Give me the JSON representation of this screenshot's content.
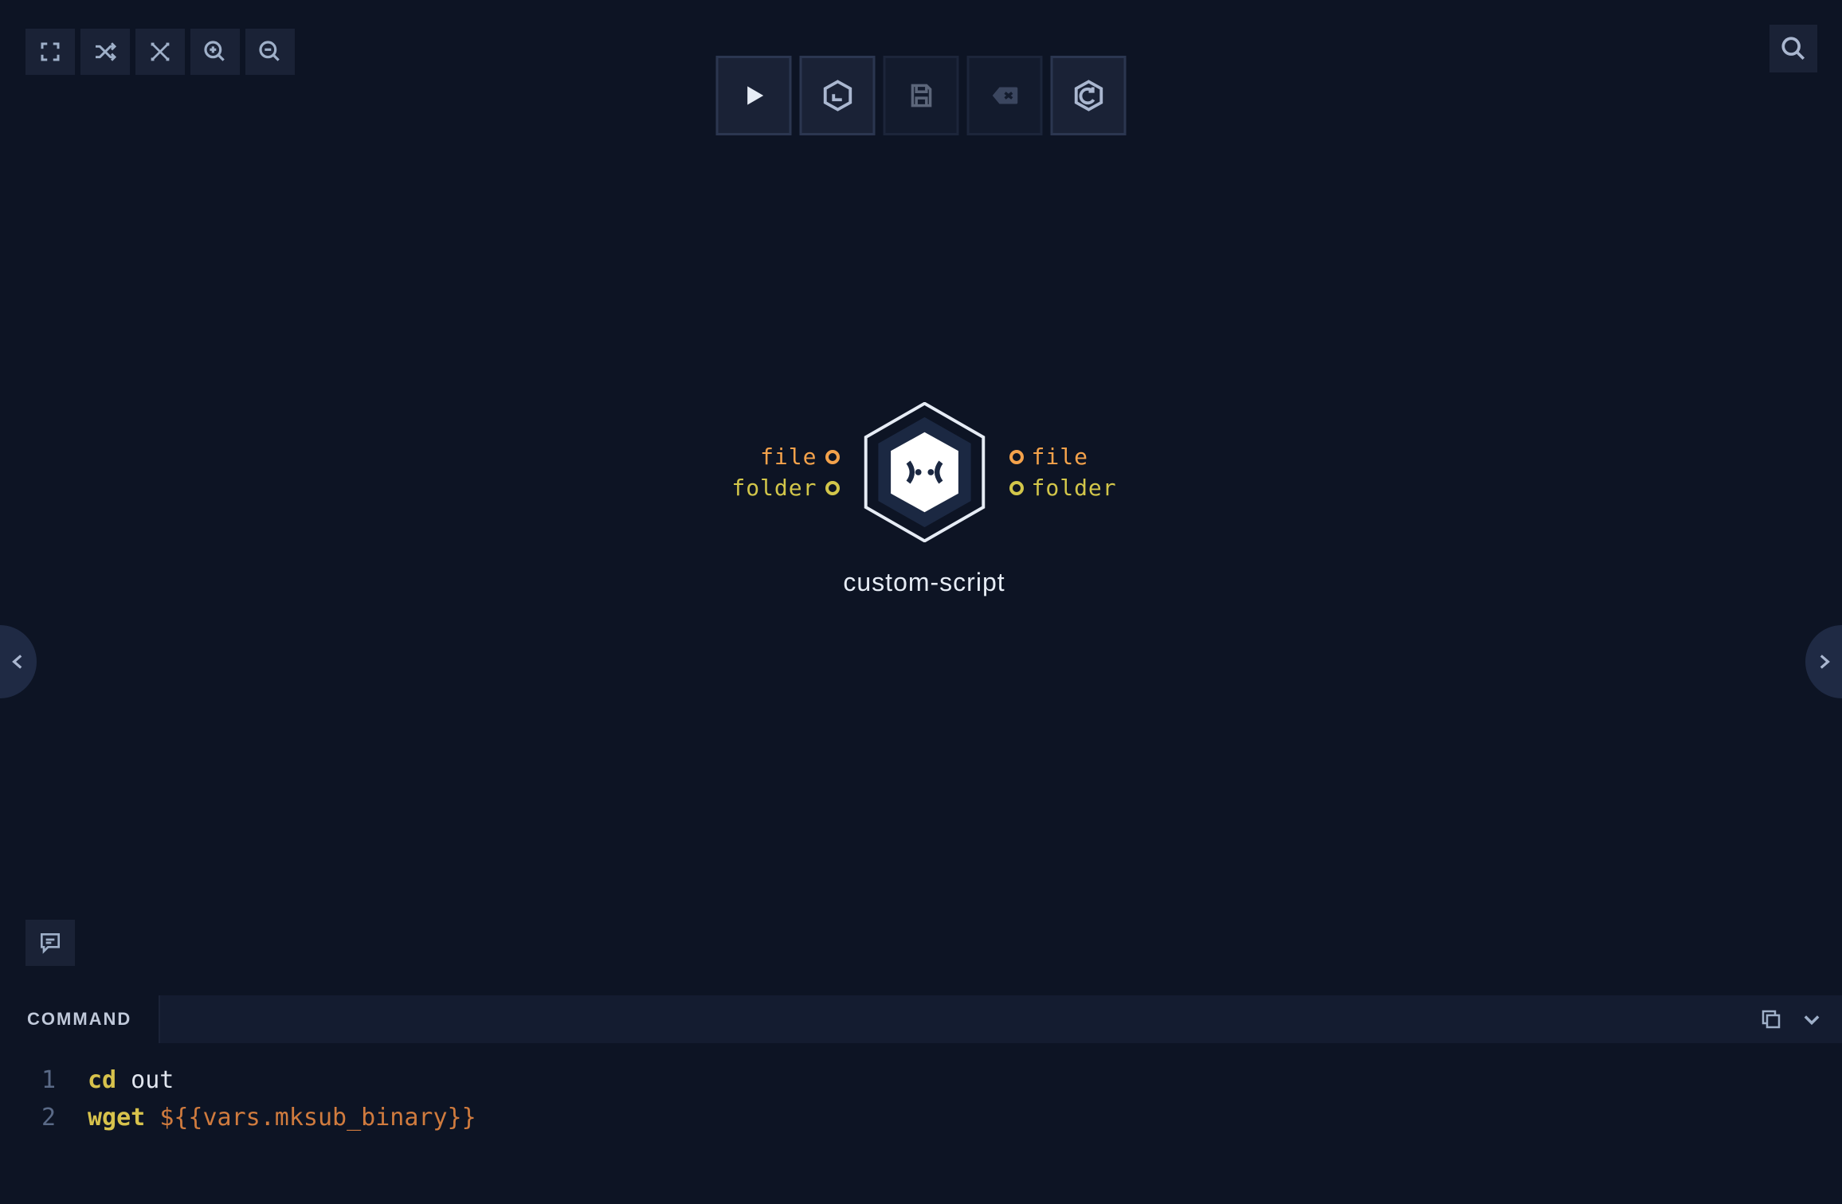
{
  "toolbar_tl": {
    "items": [
      "fullscreen-icon",
      "shuffle-icon",
      "fit-screen-icon",
      "zoom-in-icon",
      "zoom-out-icon"
    ]
  },
  "toolbar_center": {
    "items": [
      {
        "name": "run-button",
        "disabled": false
      },
      {
        "name": "stop-button",
        "disabled": false
      },
      {
        "name": "save-button",
        "disabled": true
      },
      {
        "name": "clear-button",
        "disabled": true
      },
      {
        "name": "reload-button",
        "disabled": false
      }
    ]
  },
  "toolbar_tr": {
    "item": "search-icon"
  },
  "toolbar_bl": {
    "item": "comment-icon"
  },
  "side_peek": {
    "left": "chevron-left-icon",
    "right": "chevron-right-icon"
  },
  "node": {
    "title": "custom-script",
    "inputs": [
      {
        "label": "file",
        "type": "file"
      },
      {
        "label": "folder",
        "type": "folder"
      }
    ],
    "outputs": [
      {
        "label": "file",
        "type": "file"
      },
      {
        "label": "folder",
        "type": "folder"
      }
    ]
  },
  "command_panel": {
    "tab_label": "COMMAND",
    "actions": [
      "copy-icon",
      "chevron-down-icon"
    ],
    "lines": [
      {
        "n": "1",
        "tokens": [
          {
            "t": "cmd",
            "v": "cd"
          },
          {
            "t": "text",
            "v": " out"
          }
        ]
      },
      {
        "n": "2",
        "tokens": [
          {
            "t": "cmd",
            "v": "wget"
          },
          {
            "t": "text",
            "v": " "
          },
          {
            "t": "expr",
            "v": "${{vars.mksub_binary}}"
          }
        ]
      }
    ]
  },
  "colors": {
    "bg": "#0d1424",
    "panel": "#1a2236",
    "file_port": "#f4a24b",
    "folder_port": "#d2c64a"
  }
}
